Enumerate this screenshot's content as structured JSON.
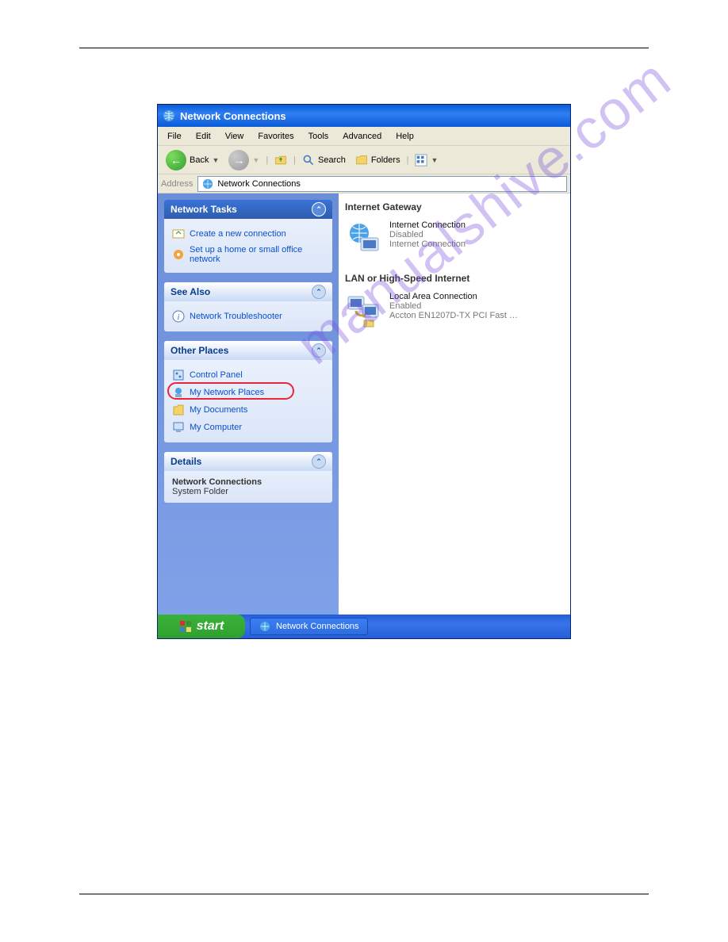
{
  "watermark": "manualshive.com",
  "window": {
    "title": "Network Connections"
  },
  "menu": {
    "file": "File",
    "edit": "Edit",
    "view": "View",
    "favorites": "Favorites",
    "tools": "Tools",
    "advanced": "Advanced",
    "help": "Help"
  },
  "toolbar": {
    "back": "Back",
    "search": "Search",
    "folders": "Folders"
  },
  "address": {
    "label": "Address",
    "value": "Network Connections"
  },
  "sidebar": {
    "network_tasks": {
      "title": "Network Tasks",
      "create": "Create a new connection",
      "setup": "Set up a home or small office network"
    },
    "see_also": {
      "title": "See Also",
      "troubleshooter": "Network Troubleshooter"
    },
    "other_places": {
      "title": "Other Places",
      "control_panel": "Control Panel",
      "my_network": "My Network Places",
      "my_documents": "My Documents",
      "my_computer": "My Computer"
    },
    "details": {
      "title": "Details",
      "name": "Network Connections",
      "type": "System Folder"
    }
  },
  "main": {
    "gateway_header": "Internet Gateway",
    "gateway": {
      "name": "Internet Connection",
      "status": "Disabled",
      "device": "Internet Connection"
    },
    "lan_header": "LAN or High-Speed Internet",
    "lan": {
      "name": "Local Area Connection",
      "status": "Enabled",
      "device": "Accton EN1207D-TX PCI Fast …"
    }
  },
  "taskbar": {
    "start": "start",
    "task": "Network Connections"
  }
}
